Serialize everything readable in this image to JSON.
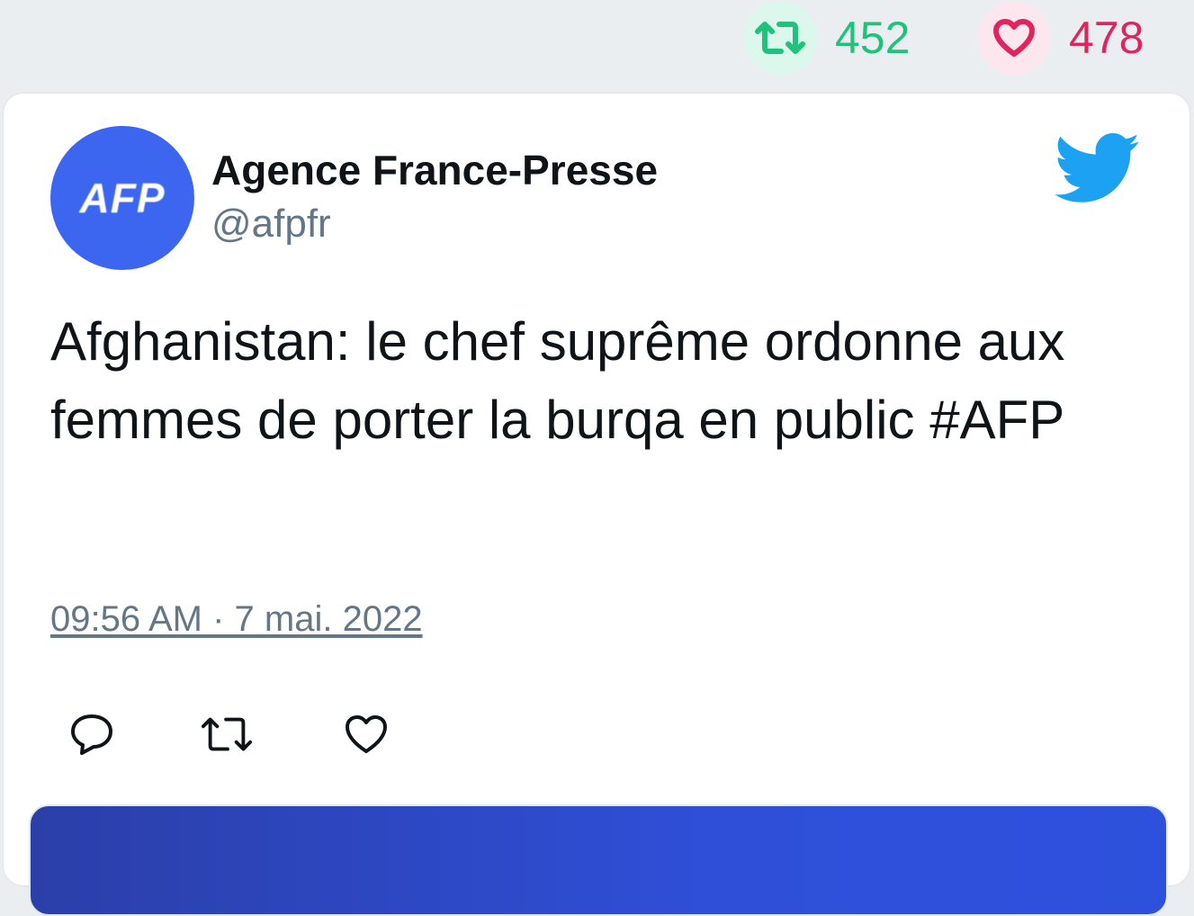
{
  "stats": {
    "retweets": "452",
    "likes": "478",
    "retweet_icon": "retweet-icon",
    "like_icon": "heart-icon"
  },
  "tweet": {
    "author_name": "Agence France-Presse",
    "author_handle": "@afpfr",
    "avatar_text": "AFP",
    "text": "Afghanistan: le chef suprême ordonne aux femmes de porter la burqa en public #AFP",
    "timestamp": "09:56 AM · 7 mai. 2022"
  },
  "actions": [
    {
      "name": "reply",
      "icon": "reply-icon"
    },
    {
      "name": "retweet",
      "icon": "retweet-icon"
    },
    {
      "name": "like",
      "icon": "heart-icon"
    }
  ],
  "colors": {
    "background": "#ebeef1",
    "card": "#ffffff",
    "retweet_green": "#1fc17b",
    "like_red": "#e0245e",
    "twitter_blue": "#1da1f2",
    "avatar_blue": "#3c66f0",
    "muted_text": "#657786",
    "main_text": "#0f1419"
  }
}
